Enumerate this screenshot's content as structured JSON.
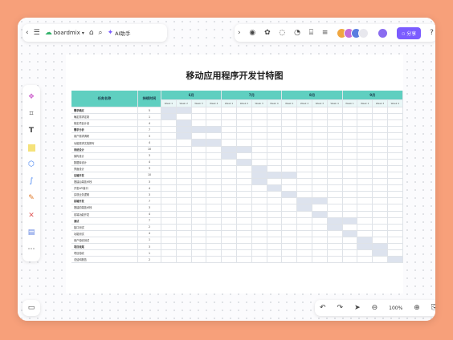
{
  "toolbar": {
    "app_name": "boardmix",
    "ai_label": "AI助手",
    "share_label": "分享",
    "zoom": "100%"
  },
  "icons": {
    "back": "chevron-left-icon",
    "menu": "menu-icon",
    "logo": "cloud-logo-icon",
    "tag": "tag-icon",
    "search": "search-icon",
    "ai": "ai-sparkle-icon"
  },
  "colors": {
    "header": "#5fcfc0",
    "bar": "#dde3ee",
    "accent": "#7b5cff",
    "background": "#f7a07a"
  },
  "gantt": {
    "title": "移动应用程序开发甘特图",
    "col_task": "任务名称",
    "col_duration": "持续时间",
    "months": [
      "6月",
      "7月",
      "8月",
      "9月"
    ],
    "weeks": [
      "Week 1",
      "Week 2",
      "Week 3",
      "Week 4"
    ],
    "tasks": [
      {
        "name": "需求确定",
        "duration": "5",
        "bold": true,
        "start": 0,
        "len": 2
      },
      {
        "name": "确定需求定制",
        "duration": "1",
        "bold": false,
        "start": 0,
        "len": 1
      },
      {
        "name": "制定项目计划",
        "duration": "4",
        "bold": false,
        "start": 1,
        "len": 1
      },
      {
        "name": "需求分析",
        "duration": "7",
        "bold": true,
        "start": 1,
        "len": 3
      },
      {
        "name": "用户需求调研",
        "duration": "3",
        "bold": false,
        "start": 1,
        "len": 1
      },
      {
        "name": "功能需求文档撰写",
        "duration": "4",
        "bold": false,
        "start": 2,
        "len": 2
      },
      {
        "name": "系统设计",
        "duration": "10",
        "bold": true,
        "start": 4,
        "len": 2
      },
      {
        "name": "架构设计",
        "duration": "3",
        "bold": false,
        "start": 4,
        "len": 1
      },
      {
        "name": "数据库设计",
        "duration": "4",
        "bold": false,
        "start": 5,
        "len": 1
      },
      {
        "name": "界面设计",
        "duration": "3",
        "bold": false,
        "start": 6,
        "len": 1
      },
      {
        "name": "后端开发",
        "duration": "10",
        "bold": true,
        "start": 6,
        "len": 3
      },
      {
        "name": "搭建后端技术栈",
        "duration": "3",
        "bold": false,
        "start": 6,
        "len": 1
      },
      {
        "name": "开发API接口",
        "duration": "4",
        "bold": false,
        "start": 7,
        "len": 1
      },
      {
        "name": "实现业务逻辑",
        "duration": "3",
        "bold": false,
        "start": 8,
        "len": 1
      },
      {
        "name": "前端开发",
        "duration": "7",
        "bold": true,
        "start": 9,
        "len": 2
      },
      {
        "name": "搭建前端技术栈",
        "duration": "3",
        "bold": false,
        "start": 9,
        "len": 1
      },
      {
        "name": "前端功能开发",
        "duration": "4",
        "bold": false,
        "start": 10,
        "len": 1
      },
      {
        "name": "测试",
        "duration": "7",
        "bold": true,
        "start": 11,
        "len": 2
      },
      {
        "name": "接口测试",
        "duration": "2",
        "bold": false,
        "start": 11,
        "len": 1
      },
      {
        "name": "功能测试",
        "duration": "4",
        "bold": false,
        "start": 12,
        "len": 1
      },
      {
        "name": "用户验收测试",
        "duration": "1",
        "bold": false,
        "start": 13,
        "len": 1
      },
      {
        "name": "项目收尾",
        "duration": "3",
        "bold": true,
        "start": 13,
        "len": 2
      },
      {
        "name": "项目验收",
        "duration": "1",
        "bold": false,
        "start": 14,
        "len": 1
      },
      {
        "name": "总结和报告",
        "duration": "2",
        "bold": false,
        "start": 15,
        "len": 1
      }
    ]
  }
}
